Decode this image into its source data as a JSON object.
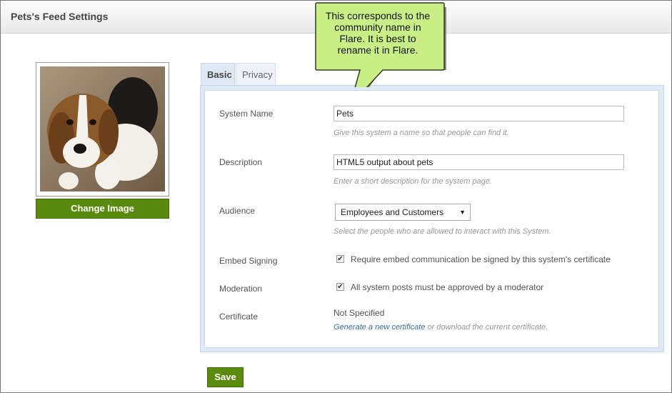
{
  "header": {
    "title": "Pets's Feed Settings"
  },
  "avatar": {
    "change_label": "Change Image"
  },
  "tabs": [
    {
      "label": "Basic",
      "active": true
    },
    {
      "label": "Privacy",
      "active": false
    }
  ],
  "form": {
    "system_name": {
      "label": "System Name",
      "value": "Pets",
      "hint": "Give this system a name so that people can find it."
    },
    "description": {
      "label": "Description",
      "value": "HTML5 output about pets",
      "hint": "Enter a short description for the system page."
    },
    "audience": {
      "label": "Audience",
      "selected": "Employees and Customers",
      "hint": "Select the people who are allowed to interact with this System."
    },
    "embed_signing": {
      "label": "Embed Signing",
      "checkbox_label": "Require embed communication be signed by this system's certificate",
      "checked": true
    },
    "moderation": {
      "label": "Moderation",
      "checkbox_label": "All system posts must be approved by a moderator",
      "checked": true
    },
    "certificate": {
      "label": "Certificate",
      "value": "Not Specified",
      "link_text": "Generate a new certificate",
      "suffix": " or download the current certificate."
    }
  },
  "save_label": "Save",
  "callout": {
    "lines": [
      "This corresponds to the",
      "community name in",
      "Flare. It is best to",
      "rename it in Flare."
    ]
  },
  "colors": {
    "button_green": "#5a8a0e",
    "callout_fill": "#c9ee86",
    "tab_active_bg": "#dfe9f5",
    "link": "#3a6ea5"
  }
}
